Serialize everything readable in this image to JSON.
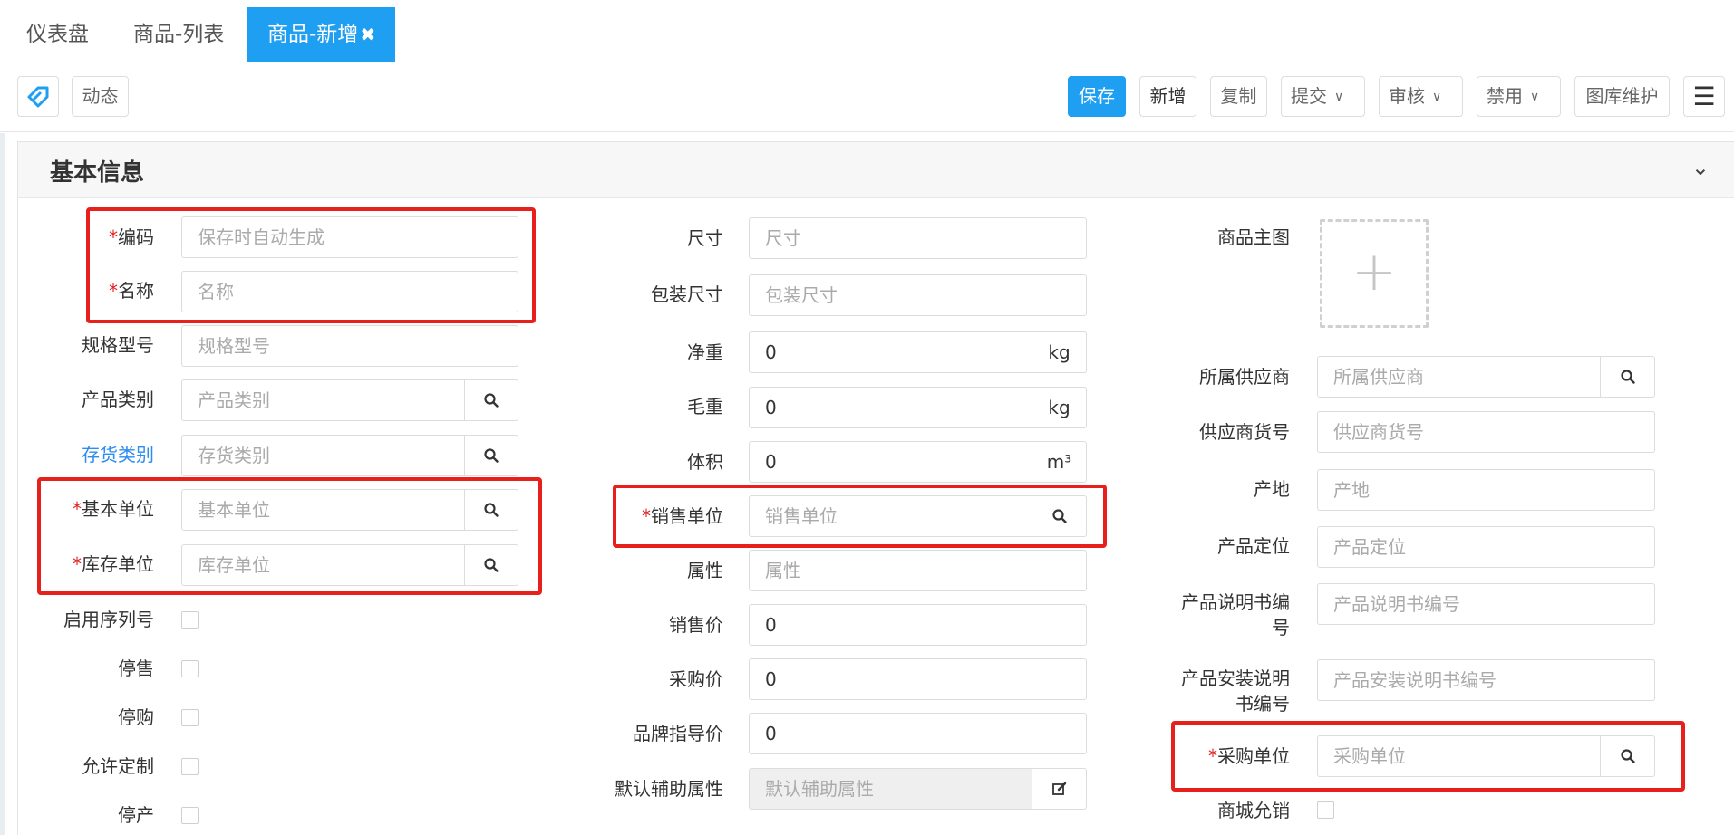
{
  "tabs": [
    {
      "label": "仪表盘"
    },
    {
      "label": "商品-列表"
    },
    {
      "label": "商品-新增",
      "close": "✖"
    }
  ],
  "toolbar": {
    "dynamic": "动态",
    "save": "保存",
    "add": "新增",
    "copy": "复制",
    "submit": "提交",
    "audit": "审核",
    "disable": "禁用",
    "gallery": "图库维护",
    "menu": "☰"
  },
  "panel": {
    "title": "基本信息",
    "collapse": "⌄"
  },
  "required_mark": "*",
  "col1": {
    "code": {
      "label": "编码",
      "placeholder": "保存时自动生成"
    },
    "name": {
      "label": "名称",
      "placeholder": "名称"
    },
    "spec": {
      "label": "规格型号",
      "placeholder": "规格型号"
    },
    "product_category": {
      "label": "产品类别",
      "placeholder": "产品类别"
    },
    "stock_category": {
      "label": "存货类别",
      "placeholder": "存货类别"
    },
    "base_unit": {
      "label": "基本单位",
      "placeholder": "基本单位"
    },
    "stock_unit": {
      "label": "库存单位",
      "placeholder": "库存单位"
    },
    "serial": {
      "label": "启用序列号"
    },
    "stop_sale": {
      "label": "停售"
    },
    "stop_purchase": {
      "label": "停购"
    },
    "customize": {
      "label": "允许定制"
    },
    "discontinued": {
      "label": "停产"
    }
  },
  "col2": {
    "size": {
      "label": "尺寸",
      "placeholder": "尺寸"
    },
    "pack_size": {
      "label": "包装尺寸",
      "placeholder": "包装尺寸"
    },
    "net_weight": {
      "label": "净重",
      "value": "0",
      "unit": "kg"
    },
    "gross_weight": {
      "label": "毛重",
      "value": "0",
      "unit": "kg"
    },
    "volume": {
      "label": "体积",
      "value": "0",
      "unit": "m³"
    },
    "sale_unit": {
      "label": "销售单位",
      "placeholder": "销售单位"
    },
    "attribute": {
      "label": "属性",
      "placeholder": "属性"
    },
    "sale_price": {
      "label": "销售价",
      "value": "0"
    },
    "purchase_price": {
      "label": "采购价",
      "value": "0"
    },
    "brand_price": {
      "label": "品牌指导价",
      "value": "0"
    },
    "default_aux": {
      "label": "默认辅助属性",
      "placeholder": "默认辅助属性"
    }
  },
  "col3": {
    "main_image": {
      "label": "商品主图",
      "upload": "+"
    },
    "supplier": {
      "label": "所属供应商",
      "placeholder": "所属供应商"
    },
    "supplier_no": {
      "label": "供应商货号",
      "placeholder": "供应商货号"
    },
    "origin": {
      "label": "产地",
      "placeholder": "产地"
    },
    "positioning": {
      "label": "产品定位",
      "placeholder": "产品定位"
    },
    "manual_no": {
      "label": "产品说明书编号",
      "placeholder": "产品说明书编号"
    },
    "install_no": {
      "label": "产品安装说明书编号",
      "placeholder": "产品安装说明书编号"
    },
    "purchase_unit": {
      "label": "采购单位",
      "placeholder": "采购单位"
    },
    "mall_allow": {
      "label": "商城允销"
    }
  },
  "colors": {
    "accent": "#1e9ff2",
    "highlight": "#e8201c",
    "required": "#e02020",
    "link": "#2d8cf0"
  },
  "icons": [
    "tag-icon",
    "search-icon",
    "edit-icon",
    "chevron-down-icon",
    "menu-icon",
    "plus-icon",
    "close-icon"
  ]
}
